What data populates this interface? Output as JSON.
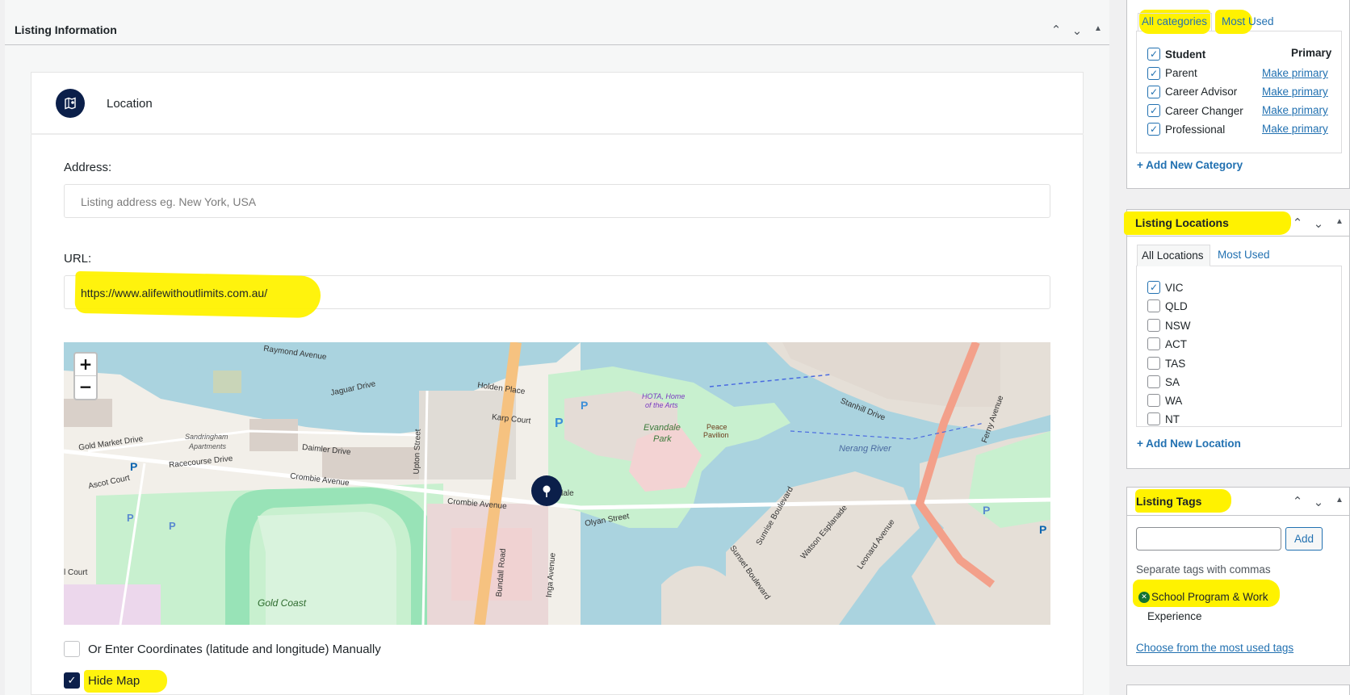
{
  "main": {
    "title": "Listing Information",
    "section_title": "Location",
    "address_label": "Address:",
    "address_placeholder": "Listing address eg. New York, USA",
    "url_label": "URL:",
    "url_value": "https://www.alifewithoutlimits.com.au/",
    "coords_label": "Or Enter Coordinates (latitude and longitude) Manually",
    "hide_map_label": "Hide Map"
  },
  "map": {
    "zoom_in": "+",
    "zoom_out": "−",
    "labels": {
      "raymond": "Raymond Avenue",
      "jaguar": "Jaguar Drive",
      "holden": "Holden Place",
      "karp": "Karp Court",
      "gold_market": "Gold Market Drive",
      "sandringham": "Sandringham",
      "apartments": "Apartments",
      "daimler": "Daimler Drive",
      "racecourse": "Racecourse Drive",
      "crombie1": "Crombie Avenue",
      "crombie2": "Crombie Avenue",
      "ascot": "Ascot Court",
      "upton": "Upton Street",
      "bundall": "Bundall Road",
      "evandale": "Evandale",
      "park": "Park",
      "peace": "Peace",
      "pavilion": "Pavilion",
      "hota": "HOTA, Home",
      "arts": "of the Arts",
      "nerang": "Nerang River",
      "stanhill": "Stanhill Drive",
      "ferny": "Ferny Avenue",
      "gold_coast": "Gold Coast",
      "watson": "Watson Esplanade",
      "leonard": "Leonard Avenue",
      "sunrise": "Sunrise Boulevard",
      "sunset": "Sunset Boulevard",
      "olyan": "Olyan Street",
      "inga": "Inga Avenue",
      "court": "l Court",
      "evandale_short": "Evandale",
      "parking": "P"
    }
  },
  "categories": {
    "tab_all": "All categories",
    "tab_most": "Most Used",
    "items": [
      {
        "label": "Student",
        "checked": true,
        "action": "Primary"
      },
      {
        "label": "Parent",
        "checked": true,
        "action": "Make primary"
      },
      {
        "label": "Career Advisor",
        "checked": true,
        "action": "Make primary"
      },
      {
        "label": "Career Changer",
        "checked": true,
        "action": "Make primary"
      },
      {
        "label": "Professional",
        "checked": true,
        "action": "Make primary"
      }
    ],
    "add_link": "+ Add New Category"
  },
  "locations": {
    "title": "Listing Locations",
    "tab_all": "All Locations",
    "tab_most": "Most Used",
    "items": [
      {
        "label": "VIC",
        "checked": true
      },
      {
        "label": "QLD",
        "checked": false
      },
      {
        "label": "NSW",
        "checked": false
      },
      {
        "label": "ACT",
        "checked": false
      },
      {
        "label": "TAS",
        "checked": false
      },
      {
        "label": "SA",
        "checked": false
      },
      {
        "label": "WA",
        "checked": false
      },
      {
        "label": "NT",
        "checked": false
      }
    ],
    "add_link": "+ Add New Location"
  },
  "tags": {
    "title": "Listing Tags",
    "add_button": "Add",
    "hint": "Separate tags with commas",
    "tag_line1": "School Program & Work",
    "tag_line2": "Experience",
    "choose_link": "Choose from the most used tags"
  },
  "colors": {
    "highlight": "#fff200",
    "accent": "#2271b1",
    "navy": "#0b1f4a"
  }
}
